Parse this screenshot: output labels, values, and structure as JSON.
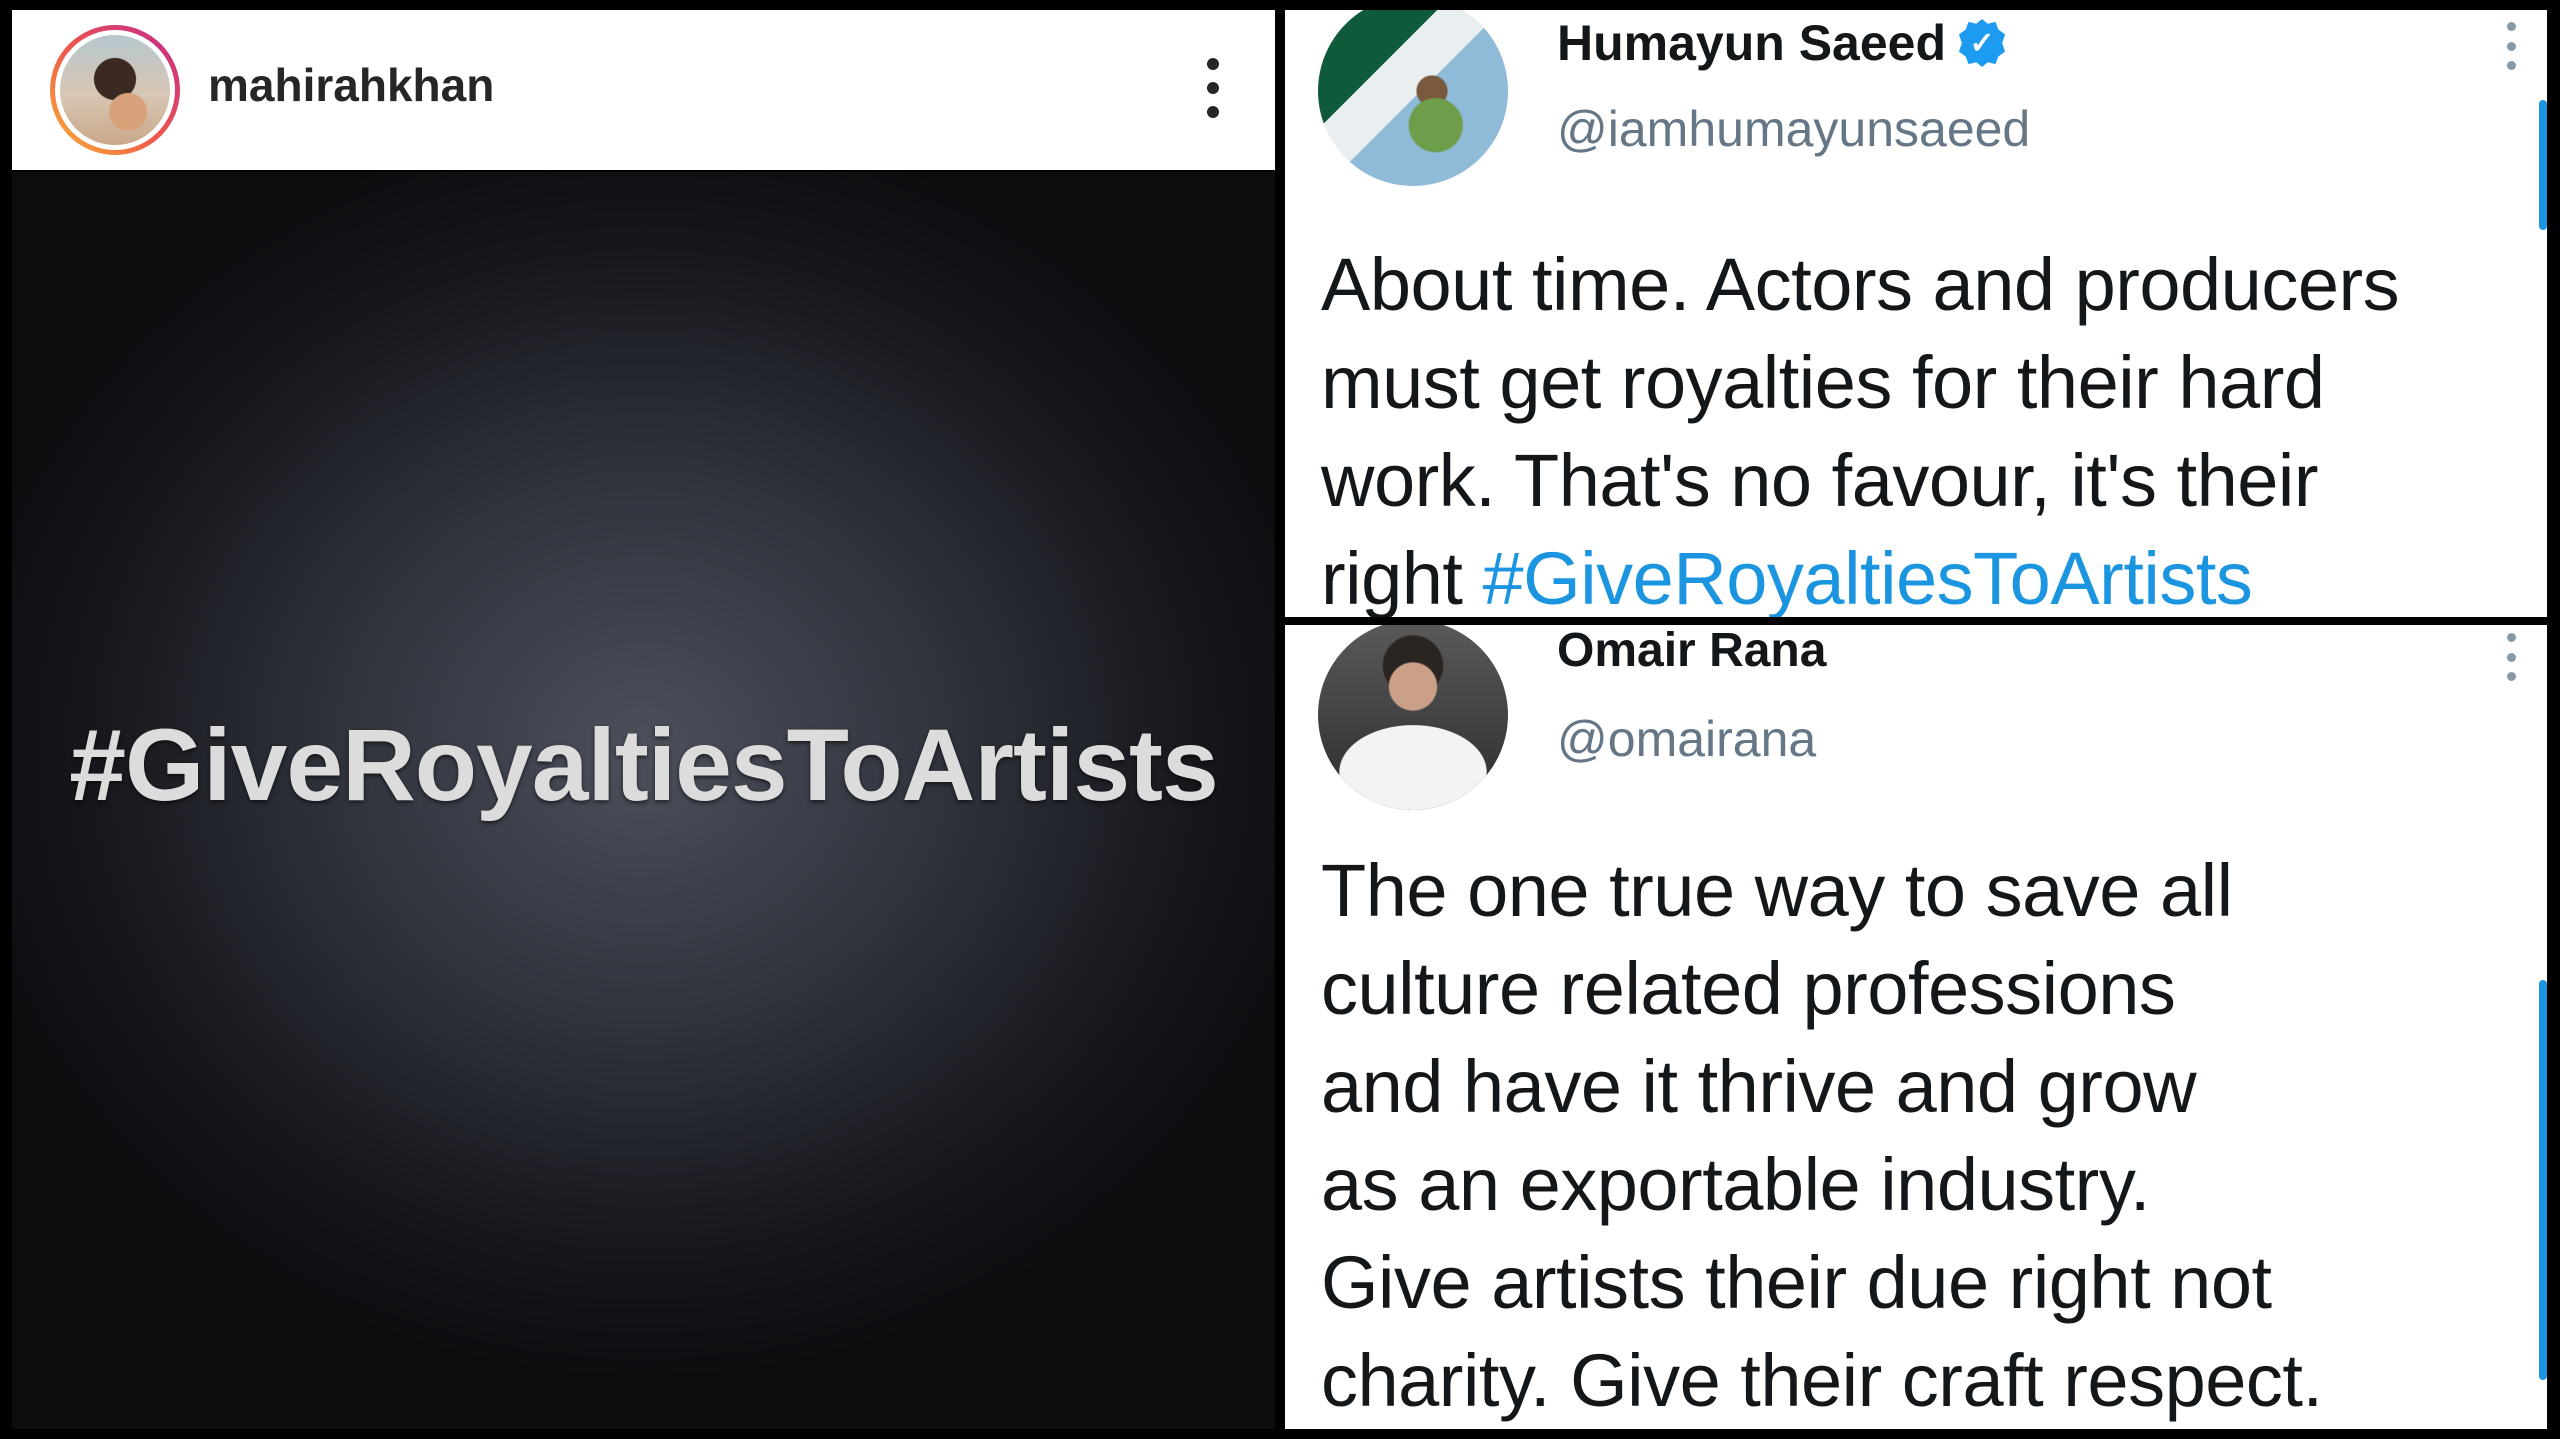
{
  "instagram": {
    "username": "mahirahkhan",
    "post_text": "#GiveRoyaltiesToArtists",
    "icons": {
      "avatar": "profile-avatar",
      "more": "more-vertical-icon"
    }
  },
  "tweets": [
    {
      "name": "Humayun Saeed",
      "verified": true,
      "verified_symbol": "✓",
      "handle": "@iamhumayunsaeed",
      "lines": [
        "About time. Actors and producers",
        "must get royalties for their hard",
        "work. That's no favour, it's their"
      ],
      "last_line_prefix": "right ",
      "hashtag": "#GiveRoyaltiesToArtists"
    },
    {
      "name": "Omair Rana",
      "verified": false,
      "handle": "@omairana",
      "lines": [
        "The one true way to save all",
        "culture related professions",
        "and have it thrive and grow",
        "as an exportable industry.",
        "Give artists their due right not",
        "charity. Give their craft respect."
      ]
    }
  ],
  "colors": {
    "twitter_blue": "#1b95e0",
    "verified_badge": "#1d9bf0",
    "instagram_ring": [
      "#f7b733",
      "#f15a4a",
      "#c0278f"
    ]
  }
}
